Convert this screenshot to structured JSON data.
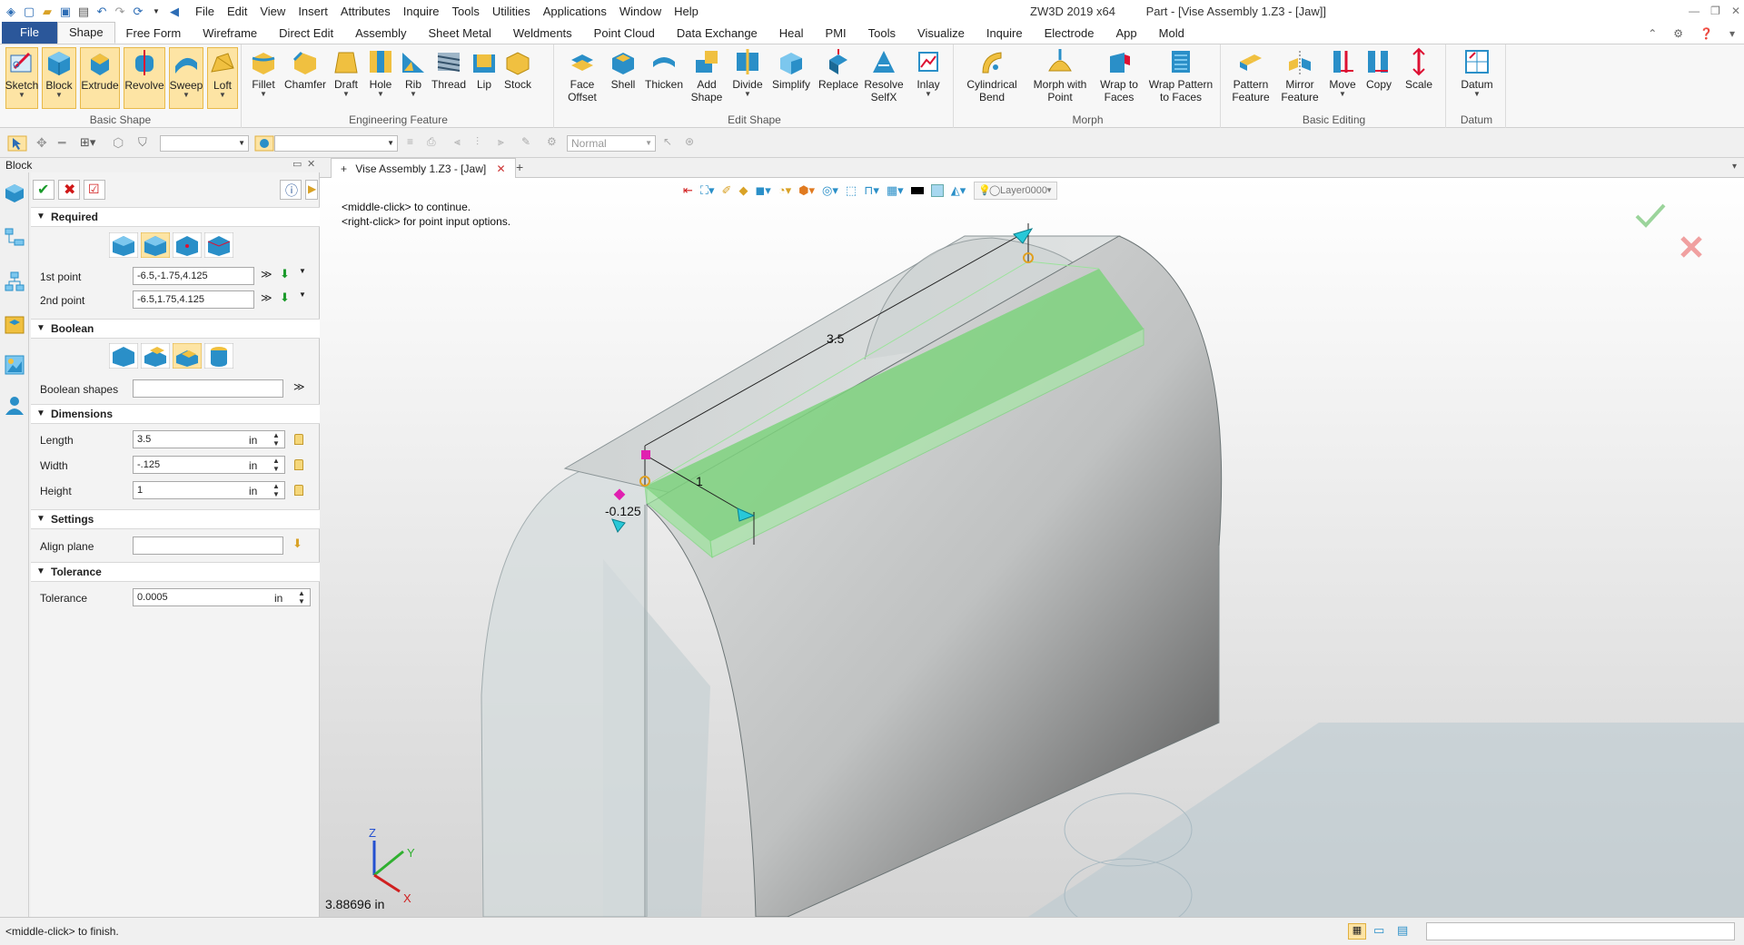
{
  "menu": {
    "items": [
      "File",
      "Edit",
      "View",
      "Insert",
      "Attributes",
      "Inquire",
      "Tools",
      "Utilities",
      "Applications",
      "Window",
      "Help"
    ],
    "app_name": "ZW3D 2019  x64",
    "doc_title": "Part - [Vise Assembly 1.Z3 - [Jaw]]"
  },
  "ribbon_tabs": [
    "File",
    "Shape",
    "Free Form",
    "Wireframe",
    "Direct Edit",
    "Assembly",
    "Sheet Metal",
    "Weldments",
    "Point Cloud",
    "Data Exchange",
    "Heal",
    "PMI",
    "Tools",
    "Visualize",
    "Inquire",
    "Electrode",
    "App",
    "Mold"
  ],
  "ribbon": {
    "groups": {
      "basic_shape": "Basic Shape",
      "engineering": "Engineering Feature",
      "edit_shape": "Edit Shape",
      "morph": "Morph",
      "basic_editing": "Basic Editing",
      "datum": "Datum"
    },
    "buttons": {
      "sketch": "Sketch",
      "block": "Block",
      "extrude": "Extrude",
      "revolve": "Revolve",
      "sweep": "Sweep",
      "loft": "Loft",
      "fillet": "Fillet",
      "chamfer": "Chamfer",
      "draft": "Draft",
      "hole": "Hole",
      "rib": "Rib",
      "thread": "Thread",
      "lip": "Lip",
      "stock": "Stock",
      "face_offset_1": "Face",
      "face_offset_2": "Offset",
      "shell": "Shell",
      "thicken": "Thicken",
      "add_shape_1": "Add",
      "add_shape_2": "Shape",
      "divide": "Divide",
      "simplify": "Simplify",
      "replace": "Replace",
      "resolve_1": "Resolve",
      "resolve_2": "SelfX",
      "inlay": "Inlay",
      "cyl_bend_1": "Cylindrical",
      "cyl_bend_2": "Bend",
      "morph_pt_1": "Morph with",
      "morph_pt_2": "Point",
      "wrap_faces_1": "Wrap to",
      "wrap_faces_2": "Faces",
      "wrap_pattern_1": "Wrap Pattern",
      "wrap_pattern_2": "to Faces",
      "pattern_1": "Pattern",
      "pattern_2": "Feature",
      "mirror_1": "Mirror",
      "mirror_2": "Feature",
      "move": "Move",
      "copy": "Copy",
      "scale": "Scale",
      "datum": "Datum"
    }
  },
  "filterbar": {
    "style_value": "Normal"
  },
  "panel": {
    "title": "Block",
    "sections": {
      "required": "Required",
      "boolean": "Boolean",
      "dimensions": "Dimensions",
      "settings": "Settings",
      "tolerance": "Tolerance"
    },
    "fields": {
      "p1_label": "1st point",
      "p1_value": "-6.5,-1.75,4.125",
      "p2_label": "2nd point",
      "p2_value": "-6.5,1.75,4.125",
      "bool_label": "Boolean shapes",
      "len_label": "Length",
      "len_value": "3.5",
      "len_unit": "in",
      "wid_label": "Width",
      "wid_value": "-.125",
      "wid_unit": "in",
      "hei_label": "Height",
      "hei_value": "1",
      "hei_unit": "in",
      "align_label": "Align plane",
      "tol_label": "Tolerance",
      "tol_value": "0.0005",
      "tol_unit": "in"
    }
  },
  "document_tab": "Vise Assembly 1.Z3 - [Jaw]",
  "viewport": {
    "hint_1": "<middle-click> to continue.",
    "hint_2": "<right-click> for point input options.",
    "layer": "Layer0000",
    "dim_length": "3.5",
    "dim_height": "1",
    "dim_width": "-0.125",
    "readout": "3.88696 in",
    "axes": {
      "x": "X",
      "y": "Y",
      "z": "Z"
    }
  },
  "status": {
    "message": "<middle-click> to finish."
  },
  "colors": {
    "accent": "#2b579a",
    "highlight": "#fde4a4",
    "preview_green": "#7ed27e",
    "handle_cyan": "#28c8d8",
    "handle_magenta": "#e020b0"
  }
}
